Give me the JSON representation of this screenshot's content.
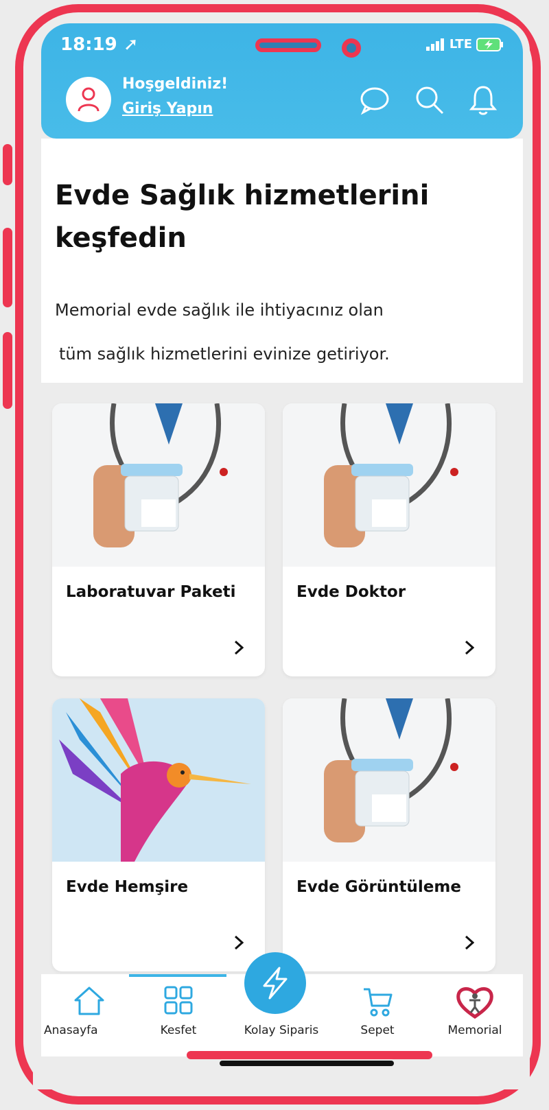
{
  "status_bar": {
    "time": "18:19",
    "network": "LTE"
  },
  "header": {
    "welcome": "Hoşgeldiniz!",
    "login_link": "Giriş Yapın",
    "icons": [
      "user-icon",
      "chat-icon",
      "search-icon",
      "bell-icon"
    ]
  },
  "intro": {
    "title": "Evde Sağlık hizmetlerini keşfedin",
    "description_line1": "Memorial evde sağlık ile ihtiyacınız olan",
    "description_line2": "tüm sağlık hizmetlerini evinize getiriyor."
  },
  "cards": [
    {
      "title": "Laboratuvar Paketi",
      "image": "doctor-holding-sample-cup"
    },
    {
      "title": "Evde Doktor",
      "image": "doctor-holding-sample-cup"
    },
    {
      "title": "Evde Hemşire",
      "image": "colorful-hummingbird"
    },
    {
      "title": "Evde Görüntüleme",
      "image": "doctor-holding-sample-cup"
    }
  ],
  "bottom_nav": {
    "items": [
      {
        "label": "Anasayfa",
        "icon": "home-icon"
      },
      {
        "label": "Kesfet",
        "icon": "grid-icon",
        "active": true
      },
      {
        "label": "Kolay Siparis",
        "icon": "lightning-icon"
      },
      {
        "label": "Sepet",
        "icon": "cart-icon"
      },
      {
        "label": "Memorial",
        "icon": "memorial-logo"
      }
    ]
  },
  "colors": {
    "header_blue": "#3db4e6",
    "frame_red": "#ed3651",
    "fab_blue": "#2ea8e0",
    "memorial_red": "#c8264a"
  }
}
